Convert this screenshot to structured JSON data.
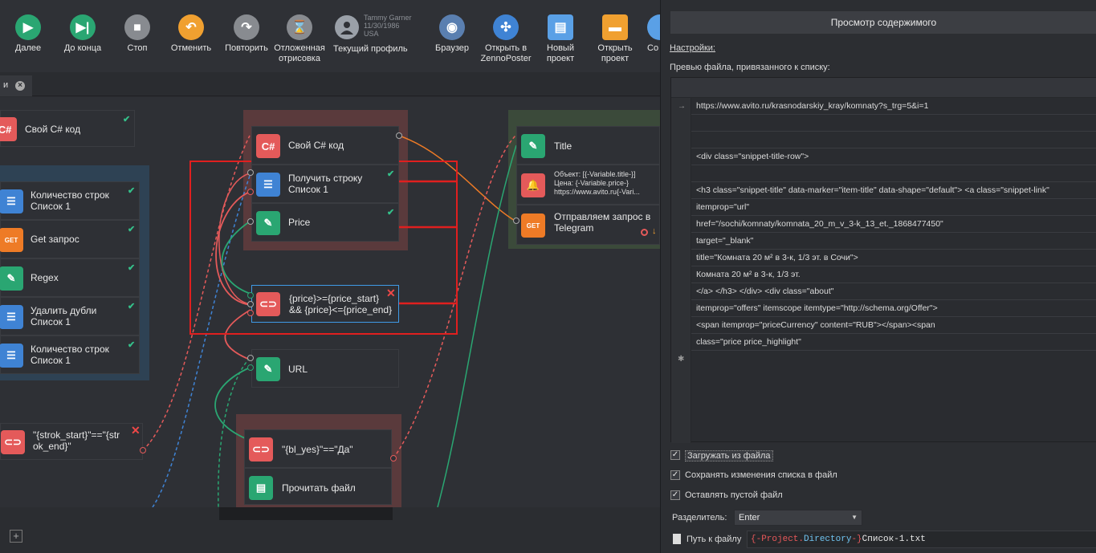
{
  "toolbar": {
    "run": "Далее",
    "run_to_end": "До конца",
    "stop": "Стоп",
    "undo": "Отменить",
    "redo": "Повторить",
    "deferred_render_1": "Отложенная",
    "deferred_render_2": "отрисовка",
    "profile": {
      "name": "Tammy Garner",
      "date": "11/30/1986",
      "country": "USA",
      "label": "Текущий профиль"
    },
    "browser": "Браузер",
    "open_in_1": "Открыть в",
    "open_in_2": "ZennoPoster",
    "new_project_1": "Новый",
    "new_project_2": "проект",
    "open_project_1": "Открыть",
    "open_project_2": "проект",
    "save_partial": "Со"
  },
  "tab": {
    "label": "и"
  },
  "nodes": {
    "left_csharp": "Свой C# код",
    "left_count_1a": "Количество строк",
    "left_count_1b": "Список 1",
    "left_get": "Get запрос",
    "left_regex": "Regex",
    "left_dedupe_a": "Удалить дубли",
    "left_dedupe_b": "Список 1",
    "left_count_2a": "Количество строк",
    "left_count_2b": "Список 1",
    "strok_cond_a": "\"{strok_start}\"==\"{str",
    "strok_cond_b": "ok_end}\"",
    "mid_csharp": "Свой C# код",
    "mid_getline_a": "Получить строку",
    "mid_getline_b": "Список 1",
    "mid_price": "Price",
    "mid_cond_a": "{price}>={price_start}",
    "mid_cond_b": "&& {price}<={price_end}",
    "mid_url": "URL",
    "bl_cond": "\"{bl_yes}\"==\"Да\"",
    "read_file": "Прочитать файл",
    "right_title": "Title",
    "right_notify_1": "Объект: [{-Variable.title-}]",
    "right_notify_2": "Цена: {-Variable.price-}",
    "right_notify_3": "https://www.avito.ru{-Vari...",
    "right_tg_a": "Отправляем запрос в",
    "right_tg_b": "Telegram",
    "csharp_icon": "C#",
    "get_icon": "GET"
  },
  "panel": {
    "title": "Просмотр содержимого",
    "settings": "Настройки:",
    "preview_label": "Превью файла, привязанного к списку:",
    "rows": [
      "https://www.avito.ru/krasnodarskiy_kray/komnaty?s_trg=5&i=1",
      "",
      "",
      "<div class=\"snippet-title-row\">",
      "",
      "<h3 class=\"snippet-title\" data-marker=\"item-title\" data-shape=\"default\"> <a class=\"snippet-link\"",
      "itemprop=\"url\"",
      "href=\"/sochi/komnaty/komnata_20_m_v_3-k_13_et._1868477450\"",
      "target=\"_blank\"",
      "title=\"Комната 20 м² в 3-к, 1/3 эт. в Сочи\">",
      "Комната 20 м² в 3-к, 1/3 эт.",
      "</a> </h3> </div>  <div class=\"about\"",
      "itemprop=\"offers\" itemscope itemtype=\"http://schema.org/Offer\">",
      "<span itemprop=\"priceCurrency\" content=\"RUB\"></span><span",
      "class=\"price price_highlight\""
    ],
    "row_marker_first": "→",
    "row_marker_new": "✱",
    "load_from_file": "Загружать из файла",
    "save_changes": "Сохранять изменения списка в файл",
    "keep_empty": "Оставлять пустой файл",
    "separator_label": "Разделитель:",
    "separator_value": "Enter",
    "path_label": "Путь к файлу",
    "path_part1": "{-Project.",
    "path_part2": "Directory",
    "path_part3": "-}",
    "path_part4": "Список-1.txt"
  },
  "colors": {
    "red_node": "#e45a5a",
    "blue_node": "#3f83d4",
    "green_node": "#2aa672",
    "orange_node": "#ee7b26",
    "highlight": "#e01f1f"
  }
}
